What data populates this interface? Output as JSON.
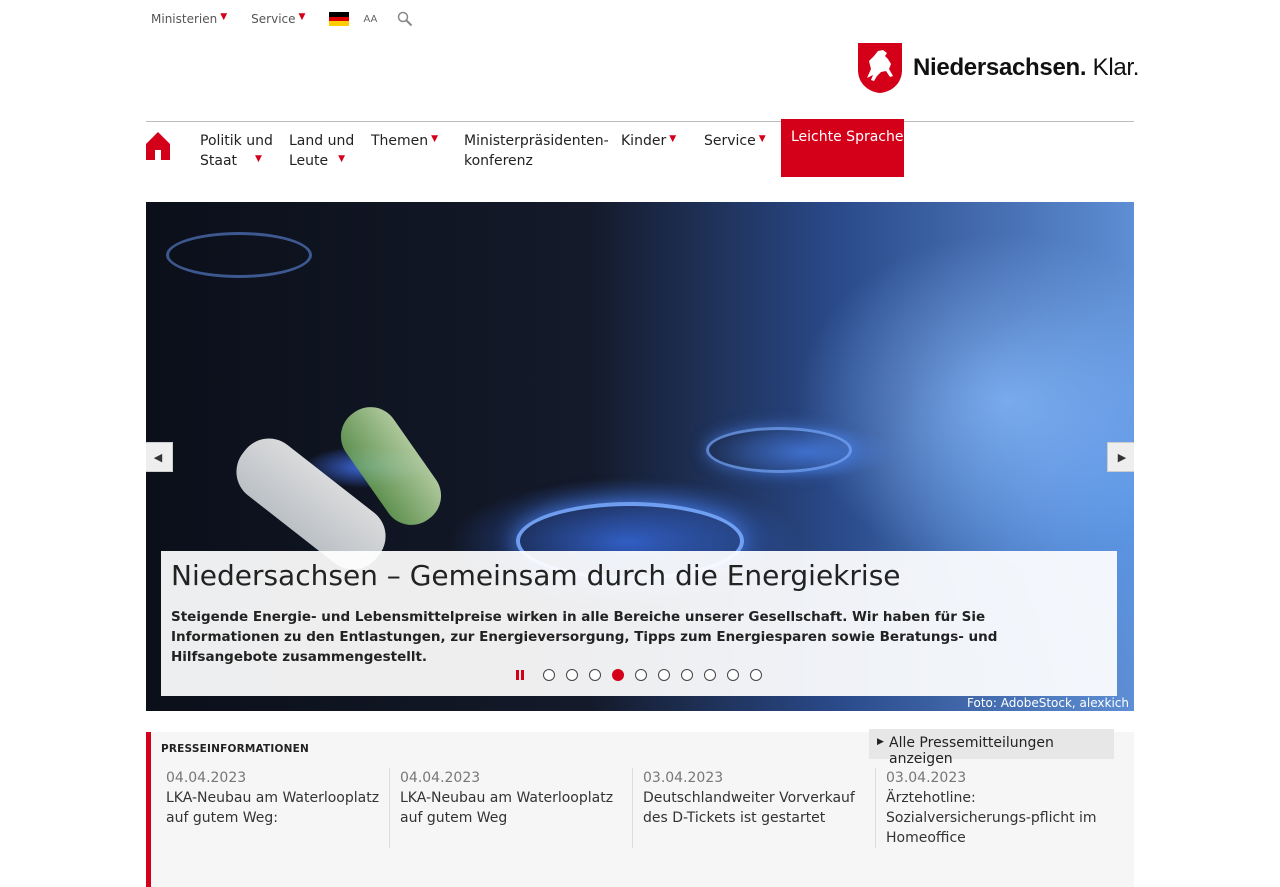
{
  "topbar": {
    "ministerien": "Ministerien",
    "service": "Service",
    "aa": "AA"
  },
  "logo": {
    "bold": "Niedersachsen.",
    "light": "Klar."
  },
  "nav": {
    "politik": [
      "Politik und",
      "Staat"
    ],
    "land": [
      "Land und",
      "Leute"
    ],
    "themen": "Themen",
    "mpk": [
      "Ministerpräsidenten-",
      "konferenz"
    ],
    "kinder": "Kinder",
    "service": "Service",
    "leichte": "Leichte Sprache"
  },
  "hero": {
    "title": "Niedersachsen – Gemeinsam durch die Energiekrise",
    "text": "Steigende Energie- und Lebensmittelpreise wirken in alle Bereiche unserer Gesellschaft. Wir haben für Sie Informationen zu den Entlastungen, zur Energieversorgung, Tipps zum Energiesparen sowie Beratungs- und Hilfsangebote zusammengestellt.",
    "credit": "Foto: AdobeStock, alexkich",
    "slide_count": 10,
    "active_slide": 4
  },
  "press": {
    "title": "PRESSEINFORMATIONEN",
    "all_label": "Alle Pressemitteilungen anzeigen",
    "items": [
      {
        "date": "04.04.2023",
        "title": "LKA-Neubau am Waterlooplatz auf gutem Weg:"
      },
      {
        "date": "04.04.2023",
        "title": "LKA-Neubau am Waterlooplatz auf gutem Weg"
      },
      {
        "date": "03.04.2023",
        "title": "Deutschlandweiter Vorverkauf des D-Tickets ist gestartet"
      },
      {
        "date": "03.04.2023",
        "title": "Ärztehotline: Sozialversicherungs-pflicht im Homeoffice"
      }
    ]
  },
  "colors": {
    "accent": "#d4001a"
  }
}
